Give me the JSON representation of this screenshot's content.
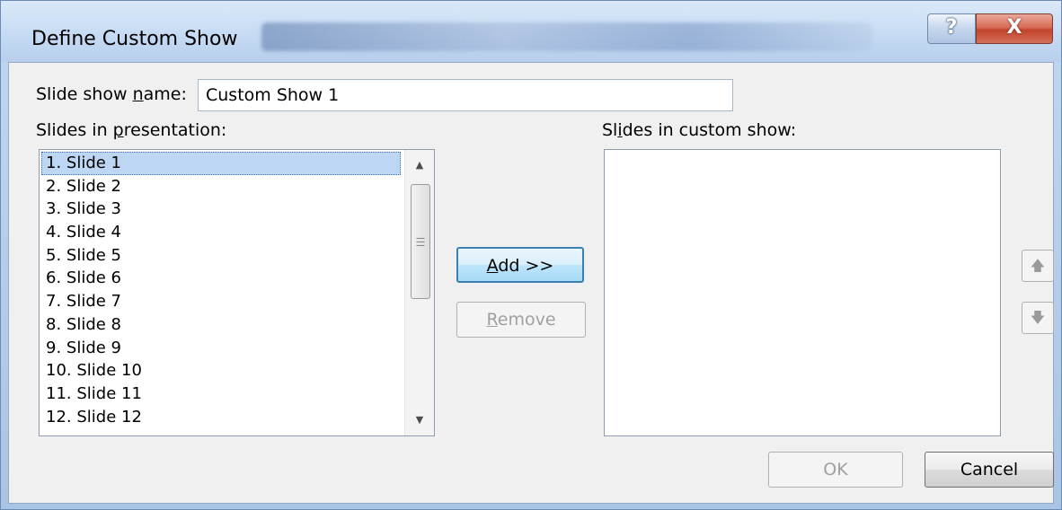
{
  "window": {
    "title": "Define Custom Show",
    "help_label": "?",
    "close_label": "X"
  },
  "form": {
    "name_label_pre": "Slide show ",
    "name_label_accel": "n",
    "name_label_post": "ame:",
    "name_value": "Custom Show 1",
    "slides_label_pre": "Slides in ",
    "slides_label_accel": "p",
    "slides_label_post": "resentation:",
    "custom_label_pre": "Sl",
    "custom_label_accel": "i",
    "custom_label_post": "des in custom show:"
  },
  "slides": [
    "1. Slide 1",
    "2. Slide 2",
    "3. Slide 3",
    "4. Slide 4",
    "5. Slide 5",
    "6. Slide 6",
    "7. Slide 7",
    "8. Slide 8",
    "9. Slide 9",
    "10. Slide 10",
    "11. Slide 11",
    "12. Slide 12"
  ],
  "selected_index": 0,
  "custom_slides": [],
  "buttons": {
    "add_accel": "A",
    "add_rest": "dd >>",
    "remove_accel": "R",
    "remove_rest": "emove",
    "ok": "OK",
    "cancel": "Cancel"
  },
  "icons": {
    "move_up": "arrow-up-icon",
    "move_down": "arrow-down-icon"
  }
}
